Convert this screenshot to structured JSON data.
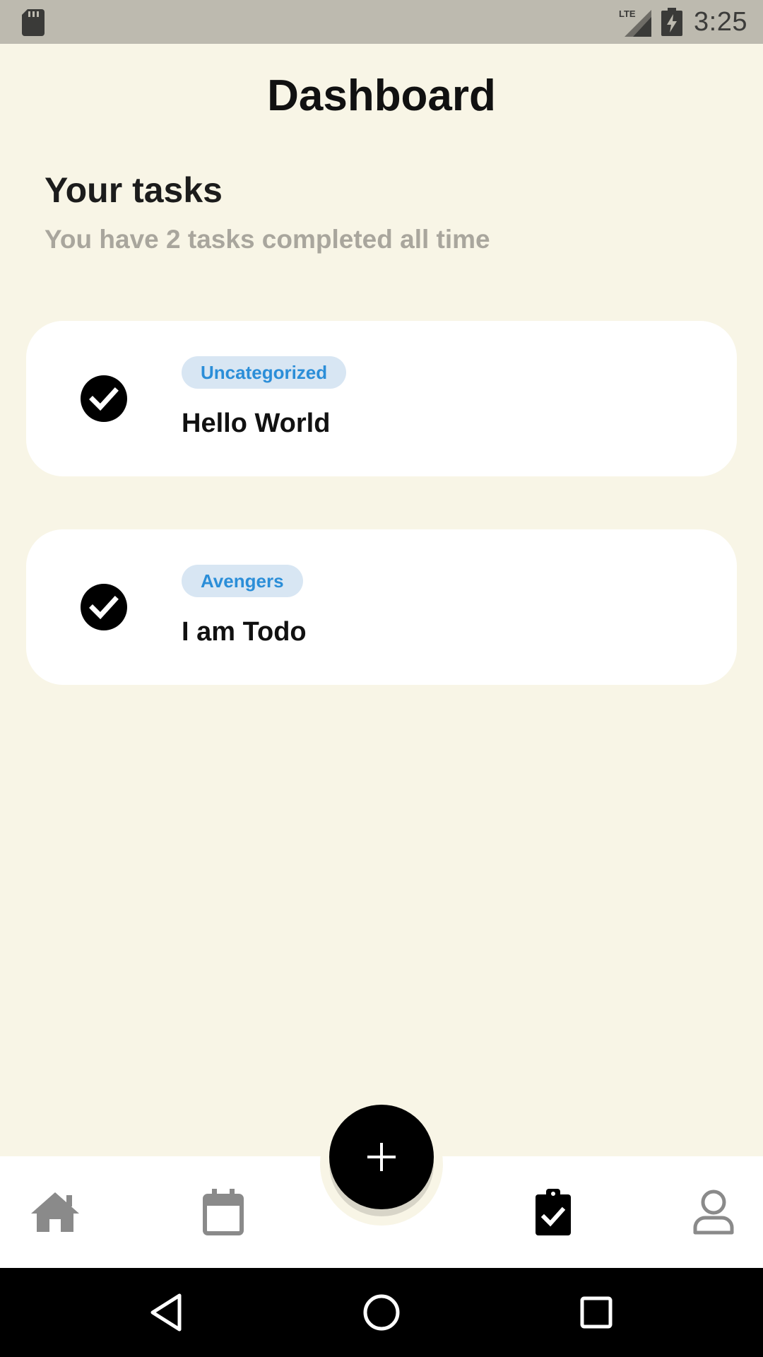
{
  "status_bar": {
    "time": "3:25",
    "network_label": "LTE",
    "icons": [
      "sd-card-icon",
      "lte-signal-icon",
      "battery-charging-icon"
    ]
  },
  "header": {
    "title": "Dashboard"
  },
  "summary": {
    "title": "Your tasks",
    "subtitle": "You have 2 tasks completed all time"
  },
  "tasks": [
    {
      "category": "Uncategorized",
      "title": "Hello World",
      "completed": true
    },
    {
      "category": "Avengers",
      "title": "I am Todo",
      "completed": true
    }
  ],
  "bottom_nav": {
    "items": [
      {
        "id": "home",
        "icon": "home-icon",
        "active": false
      },
      {
        "id": "calendar",
        "icon": "calendar-icon",
        "active": false
      },
      {
        "id": "tasks",
        "icon": "clipboard-check-icon",
        "active": true
      },
      {
        "id": "profile",
        "icon": "user-icon",
        "active": false
      }
    ],
    "fab_icon": "plus-icon"
  },
  "system_nav": {
    "icons": [
      "back-icon",
      "home-circle-icon",
      "recents-icon"
    ]
  },
  "colors": {
    "background": "#F8F5E6",
    "status_bar": "#BDBAAF",
    "card": "#FFFFFF",
    "chip_bg": "#D8E6F3",
    "chip_text": "#2B8ED8",
    "subtitle": "#A9A69D",
    "nav_inactive": "#8A8A8A",
    "nav_active": "#000000"
  }
}
